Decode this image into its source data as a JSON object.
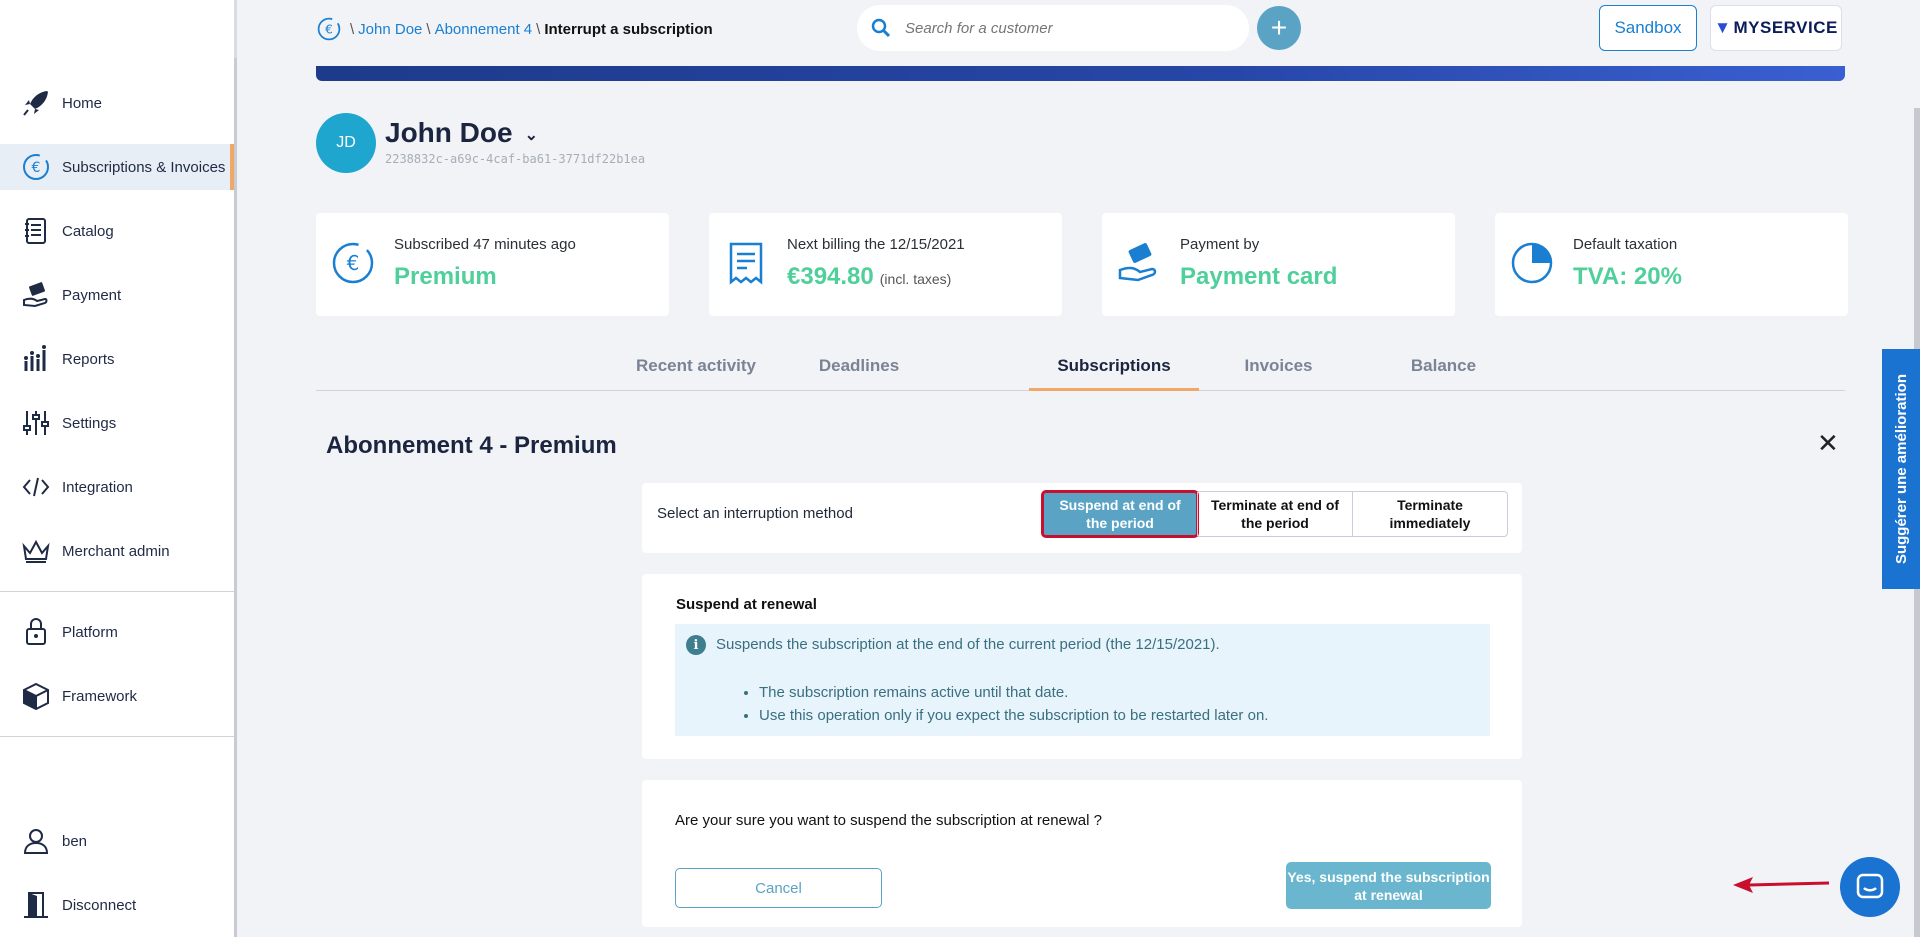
{
  "sidebar": {
    "items": [
      {
        "label": "Home",
        "icon": "rocket-icon"
      },
      {
        "label": "Subscriptions & Invoices",
        "icon": "euro-cycle-icon"
      },
      {
        "label": "Catalog",
        "icon": "notebook-icon"
      },
      {
        "label": "Payment",
        "icon": "hand-money-icon"
      },
      {
        "label": "Reports",
        "icon": "bar-chart-icon"
      },
      {
        "label": "Settings",
        "icon": "sliders-icon"
      },
      {
        "label": "Integration",
        "icon": "code-icon"
      },
      {
        "label": "Merchant admin",
        "icon": "crown-icon"
      },
      {
        "label": "Platform",
        "icon": "lock-icon"
      },
      {
        "label": "Framework",
        "icon": "box-icon"
      },
      {
        "label": "ben",
        "icon": "user-icon"
      },
      {
        "label": "Disconnect",
        "icon": "door-icon"
      }
    ]
  },
  "breadcrumb": {
    "customer": "John Doe",
    "subscription": "Abonnement 4",
    "current": "Interrupt a subscription"
  },
  "search": {
    "placeholder": "Search for a customer"
  },
  "header": {
    "plus": "+",
    "sandbox": "Sandbox",
    "logo_text": "MYSERVICE"
  },
  "customer": {
    "initials": "JD",
    "name": "John Doe",
    "id": "2238832c-a69c-4caf-ba61-3771df22b1ea"
  },
  "cards": [
    {
      "label": "Subscribed 47 minutes ago",
      "value": "Premium",
      "sub": ""
    },
    {
      "label": "Next billing the 12/15/2021",
      "value": "€394.80",
      "sub": "(incl. taxes)"
    },
    {
      "label": "Payment by",
      "value": "Payment card",
      "sub": ""
    },
    {
      "label": "Default taxation",
      "value": "TVA: 20%",
      "sub": ""
    }
  ],
  "tabs": [
    {
      "label": "Recent activity"
    },
    {
      "label": "Deadlines"
    },
    {
      "label": "Subscriptions"
    },
    {
      "label": "Invoices"
    },
    {
      "label": "Balance"
    }
  ],
  "subscription_title": "Abonnement 4 - Premium",
  "interruption": {
    "label": "Select an interruption method",
    "options": [
      {
        "label": "Suspend at end of the period"
      },
      {
        "label": "Terminate at end of the period"
      },
      {
        "label": "Terminate immediately"
      }
    ],
    "selected": "Suspend at end of the period"
  },
  "info": {
    "title": "Suspend at renewal",
    "text": "Suspends the subscription at the end of the current period (the 12/15/2021).",
    "bullets": [
      "The subscription remains active until that date.",
      "Use this operation only if you expect the subscription to be restarted later on."
    ]
  },
  "confirm": {
    "question": "Are your sure you want to suspend the subscription at renewal ?",
    "cancel": "Cancel",
    "yes": "Yes, suspend the subscription at renewal"
  },
  "feedback": {
    "label": "Suggérer une amélioration"
  },
  "colors": {
    "accent": "#1a7fd1",
    "teal": "#5aa3c4",
    "green": "#4fcf9a",
    "highlight": "#c8102e",
    "tab_underline": "#f0a868"
  }
}
